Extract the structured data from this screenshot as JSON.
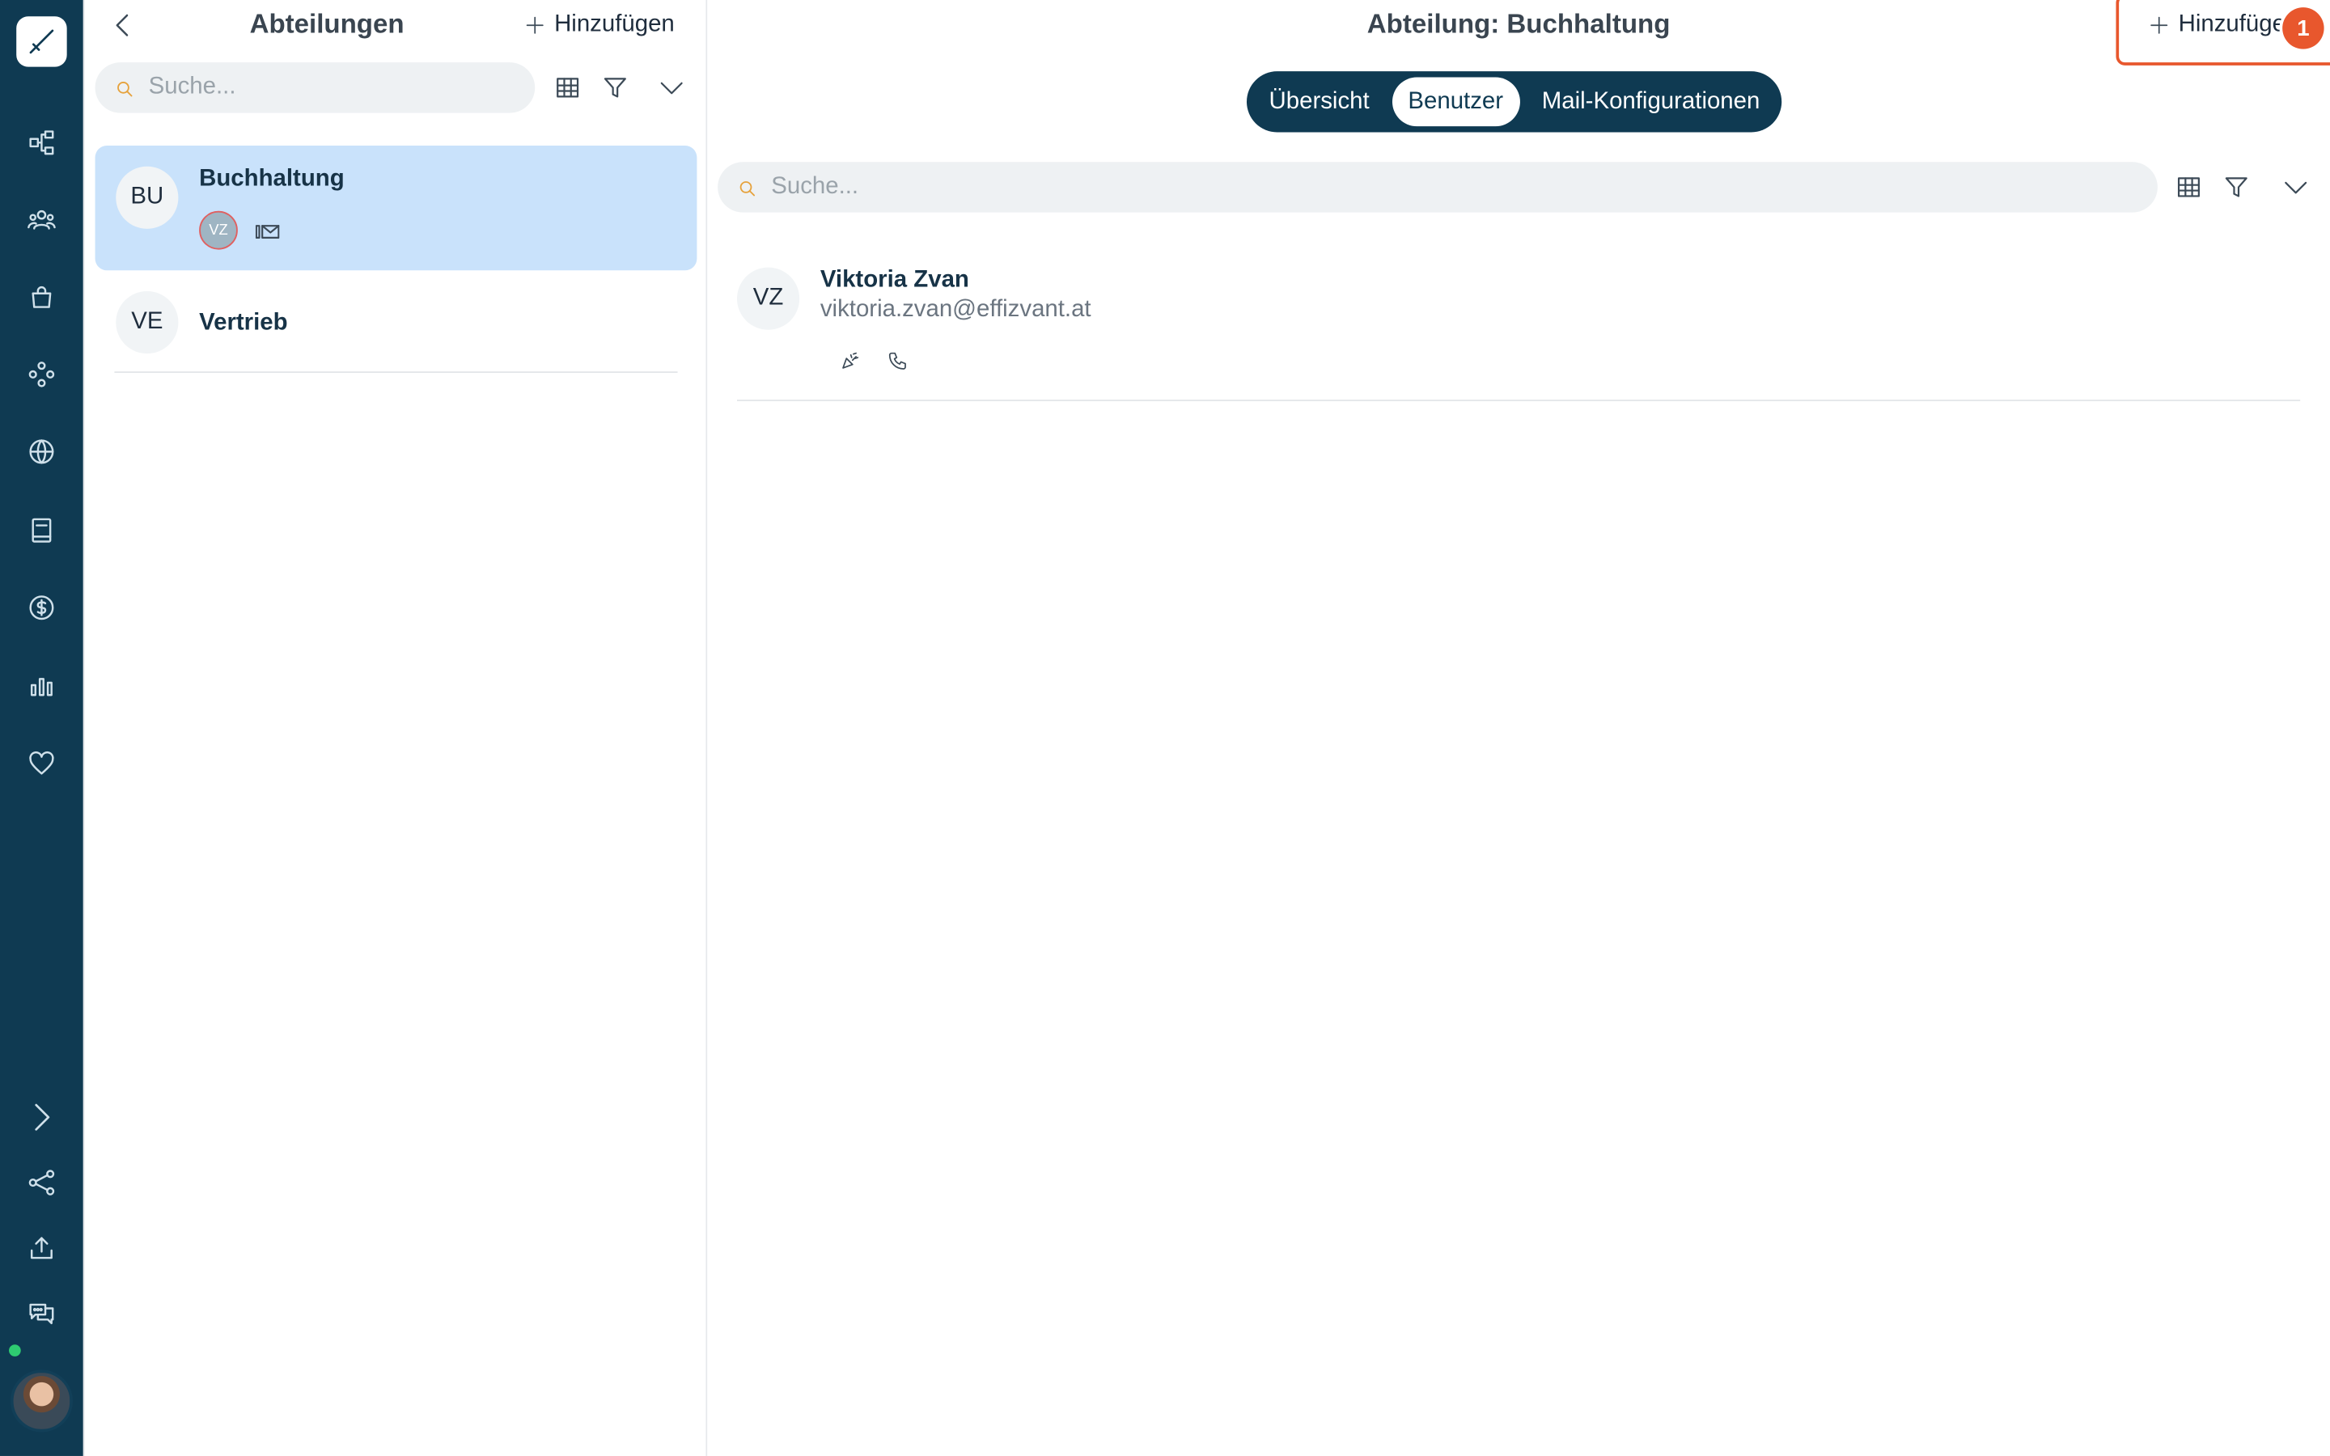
{
  "sidebar": {
    "icons": [
      "logo-icon",
      "hierarchy-icon",
      "users-icon",
      "shopping-bag-icon",
      "modules-icon",
      "globe-icon",
      "book-icon",
      "dollar-icon",
      "bar-chart-icon",
      "heart-icon"
    ],
    "bottom_icons": [
      "chevron-right-icon",
      "share-icon",
      "upload-icon",
      "chat-icon"
    ],
    "status_color": "#2ecc71"
  },
  "departments_panel": {
    "title": "Abteilungen",
    "add_label": "Hinzufügen",
    "search_placeholder": "Suche...",
    "items": [
      {
        "initials": "BU",
        "name": "Buchhaltung",
        "member_chip": "VZ",
        "selected": true
      },
      {
        "initials": "VE",
        "name": "Vertrieb",
        "selected": false
      }
    ]
  },
  "detail_panel": {
    "title": "Abteilung: Buchhaltung",
    "add_label": "Hinzufüge",
    "badge": "1",
    "tabs": [
      {
        "label": "Übersicht",
        "active": false
      },
      {
        "label": "Benutzer",
        "active": true
      },
      {
        "label": "Mail-Konfigurationen",
        "active": false
      }
    ],
    "search_placeholder": "Suche...",
    "users": [
      {
        "initials": "VZ",
        "name": "Viktoria Zvan",
        "email": "viktoria.zvan@effizvant.at"
      }
    ]
  },
  "colors": {
    "rail": "#0f3a52",
    "selected_card": "#c9e2fb",
    "highlight": "#e8572d"
  }
}
